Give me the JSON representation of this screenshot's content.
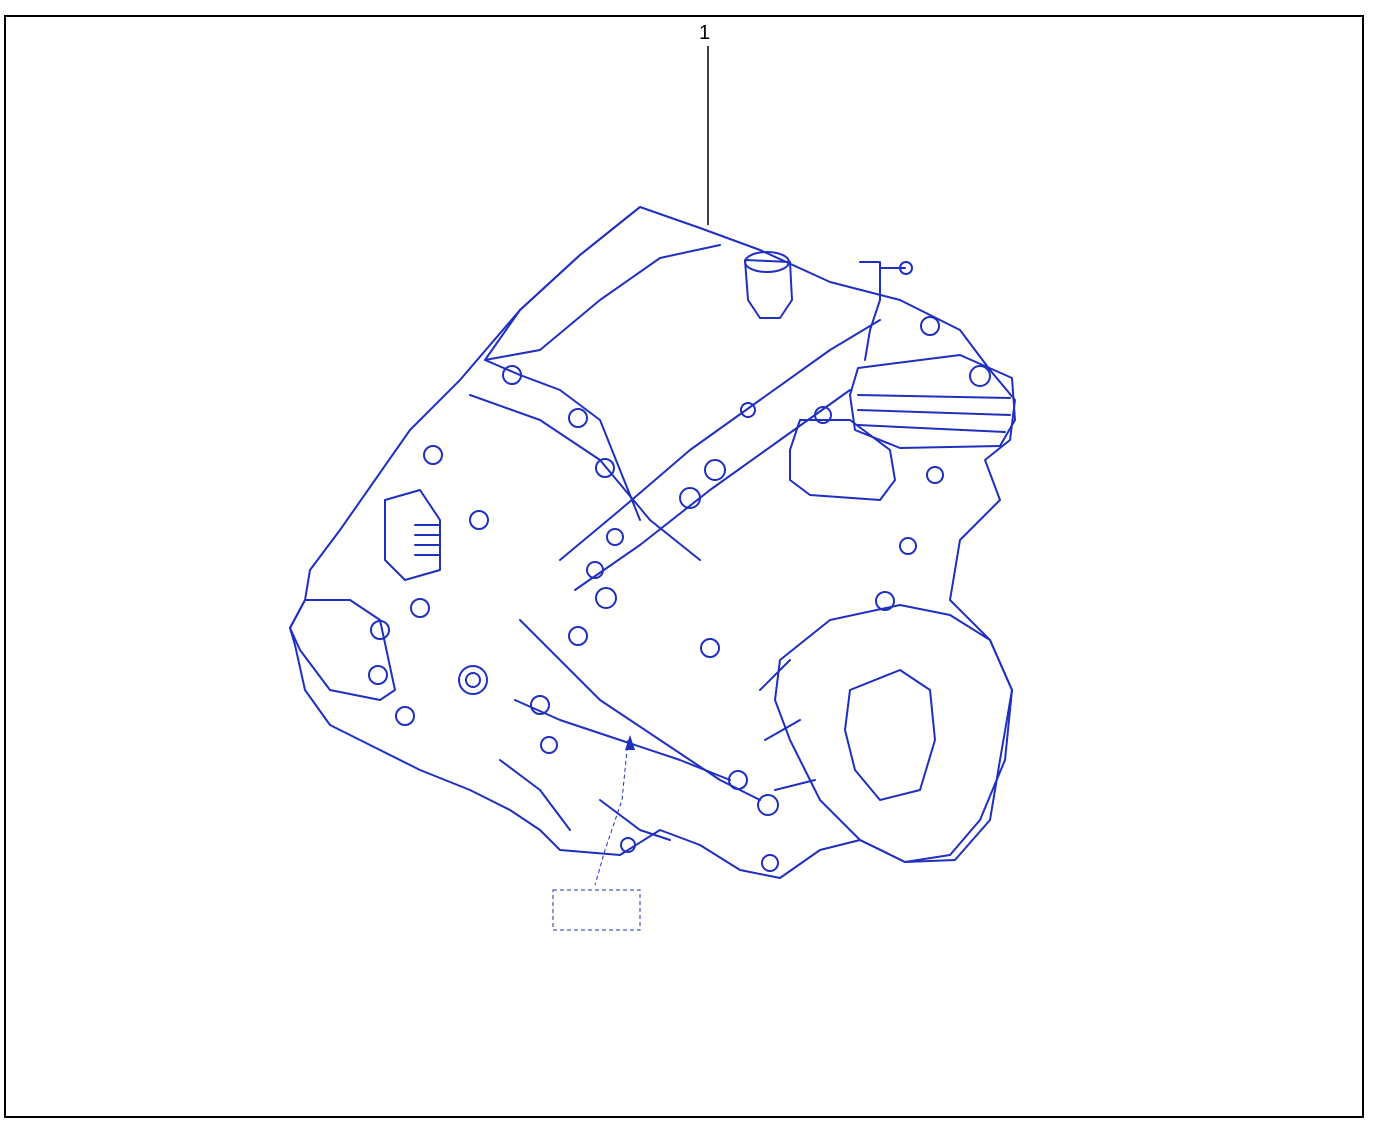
{
  "diagram": {
    "callouts": [
      {
        "label": "1"
      }
    ],
    "line_color": "#1f2fbf",
    "frame_color": "#000000",
    "subject_icon": "transmission-gearbox-assembly-drawing"
  }
}
